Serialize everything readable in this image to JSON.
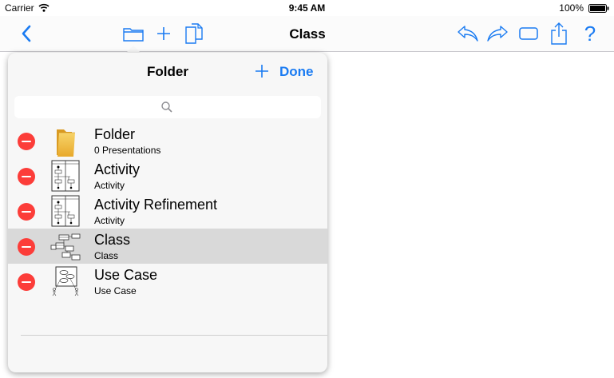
{
  "status": {
    "carrier": "Carrier",
    "time": "9:45 AM",
    "battery": "100%"
  },
  "navbar": {
    "title": "Class",
    "help": "?"
  },
  "popover": {
    "title": "Folder",
    "done": "Done",
    "items": [
      {
        "title": "Folder",
        "subtitle": "0 Presentations",
        "icon": "folder-icon"
      },
      {
        "title": "Activity",
        "subtitle": "Activity",
        "icon": "activity-diagram-icon"
      },
      {
        "title": "Activity Refinement",
        "subtitle": "Activity",
        "icon": "activity-diagram-icon"
      },
      {
        "title": "Class",
        "subtitle": "Class",
        "icon": "class-diagram-icon",
        "selected": true
      },
      {
        "title": "Use Case",
        "subtitle": "Use Case",
        "icon": "use-case-diagram-icon"
      }
    ]
  },
  "colors": {
    "accent": "#1a7bf2",
    "delete": "#fc3d39",
    "selected_row": "#d9d9d9"
  }
}
